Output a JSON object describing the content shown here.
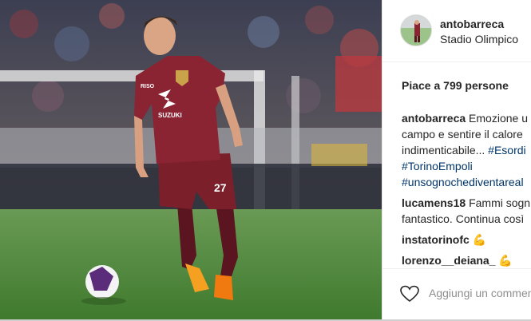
{
  "post": {
    "username": "antobarreca",
    "location": "Stadio Olimpico",
    "likes": "Piace a 799 persone"
  },
  "caption": {
    "user": "antobarreca",
    "line1": "Emozione u",
    "line2": "campo e sentire il calore",
    "line3_text": "indimenticabile... ",
    "line3_tag": "#Esordi",
    "tag2": "#TorinoEmpoli",
    "tag3": "#unsognochediventareal"
  },
  "comments": [
    {
      "user": "lucamens18",
      "text_line1": "Fammi sogn",
      "text_line2": "fantastico. Continua così"
    },
    {
      "user": "instatorinofc",
      "emoji": "💪"
    },
    {
      "user": "lorenzo__deiana_",
      "emoji": "💪"
    }
  ],
  "footer": {
    "placeholder": "Aggiungi un commen"
  },
  "photo": {
    "kit_text_sponsor": "SUZUKI",
    "kit_text_sub": "RISO",
    "shirt_number": "27"
  },
  "colors": {
    "torino_maroon": "#7b1f2a",
    "grass": "#4f8a3a",
    "hashtag": "#003569"
  }
}
